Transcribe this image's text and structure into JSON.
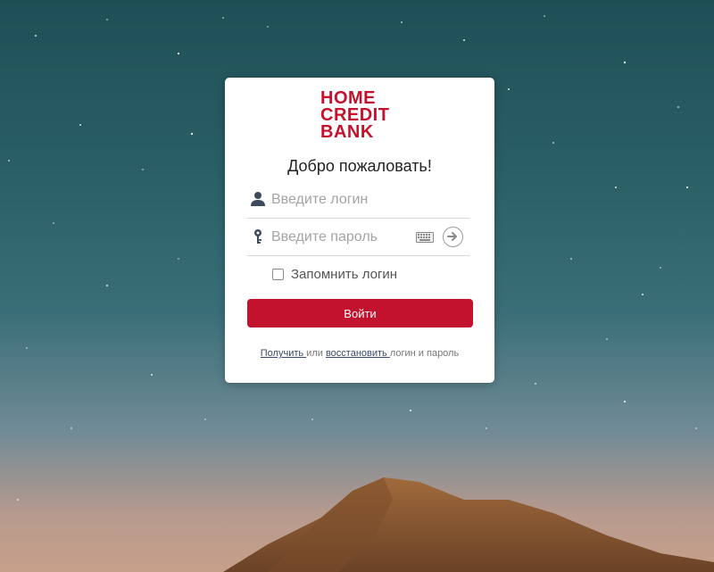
{
  "logo": {
    "line1": "HOME",
    "line2": "CREDIT",
    "line3": "BANK"
  },
  "welcome": "Добро пожаловать!",
  "login": {
    "placeholder": "Введите логин",
    "value": ""
  },
  "password": {
    "placeholder": "Введите пароль",
    "value": ""
  },
  "remember_label": "Запомнить логин",
  "login_button": "Войти",
  "footer": {
    "get_link": "Получить ",
    "or_text": "или",
    "restore_link": "восстановить ",
    "tail_text": "логин и пароль"
  },
  "colors": {
    "brand": "#c3122e",
    "background_sky": "#2a5f66",
    "mountain": "#8a5a33"
  }
}
